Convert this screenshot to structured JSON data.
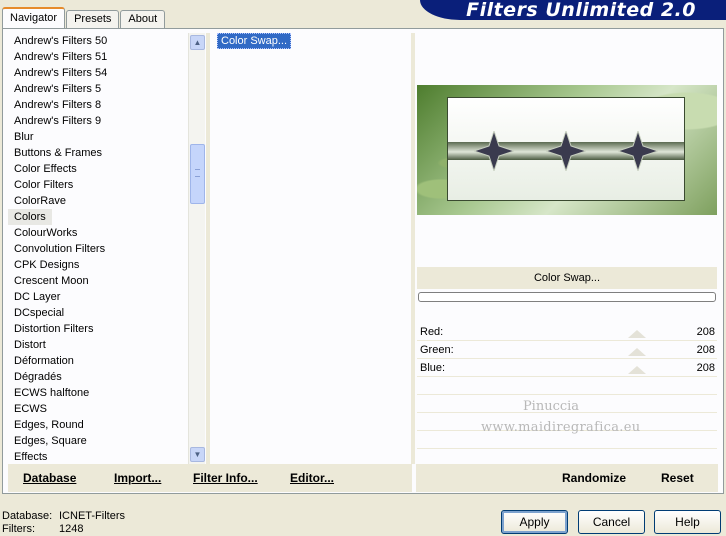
{
  "app": {
    "title": "Filters Unlimited 2.0"
  },
  "tabs": [
    {
      "label": "Navigator"
    },
    {
      "label": "Presets"
    },
    {
      "label": "About"
    }
  ],
  "categories": [
    "Andrew's Filters 50",
    "Andrew's Filters 51",
    "Andrew's Filters 54",
    "Andrew's Filters 5",
    "Andrew's Filters 8",
    "Andrew's Filters 9",
    "Blur",
    "Buttons & Frames",
    "Color Effects",
    "Color Filters",
    "ColorRave",
    "Colors",
    "ColourWorks",
    "Convolution Filters",
    "CPK Designs",
    "Crescent Moon",
    "DC Layer",
    "DCspecial",
    "Distortion Filters",
    "Distort",
    "Déformation",
    "Dégradés",
    "ECWS halftone",
    "ECWS",
    "Edges, Round",
    "Edges, Square",
    "Effects"
  ],
  "selected_category": "Colors",
  "filters": [
    "Color Swap..."
  ],
  "preview": {
    "title": "Color Swap..."
  },
  "sliders": [
    {
      "label": "Red:",
      "value": "208",
      "level": 208
    },
    {
      "label": "Green:",
      "value": "208",
      "level": 208
    },
    {
      "label": "Blue:",
      "value": "208",
      "level": 208
    }
  ],
  "watermark": {
    "line1": "Pinuccia",
    "line2": "www.maidiregrafica.eu"
  },
  "toolbar": {
    "database": "Database",
    "import": "Import...",
    "filter_info": "Filter Info...",
    "editor": "Editor...",
    "randomize": "Randomize",
    "reset": "Reset"
  },
  "info": {
    "database_label": "Database:",
    "database_value": "ICNET-Filters",
    "filters_label": "Filters:",
    "filters_value": "1248"
  },
  "buttons": {
    "apply": "Apply",
    "cancel": "Cancel",
    "help": "Help"
  }
}
